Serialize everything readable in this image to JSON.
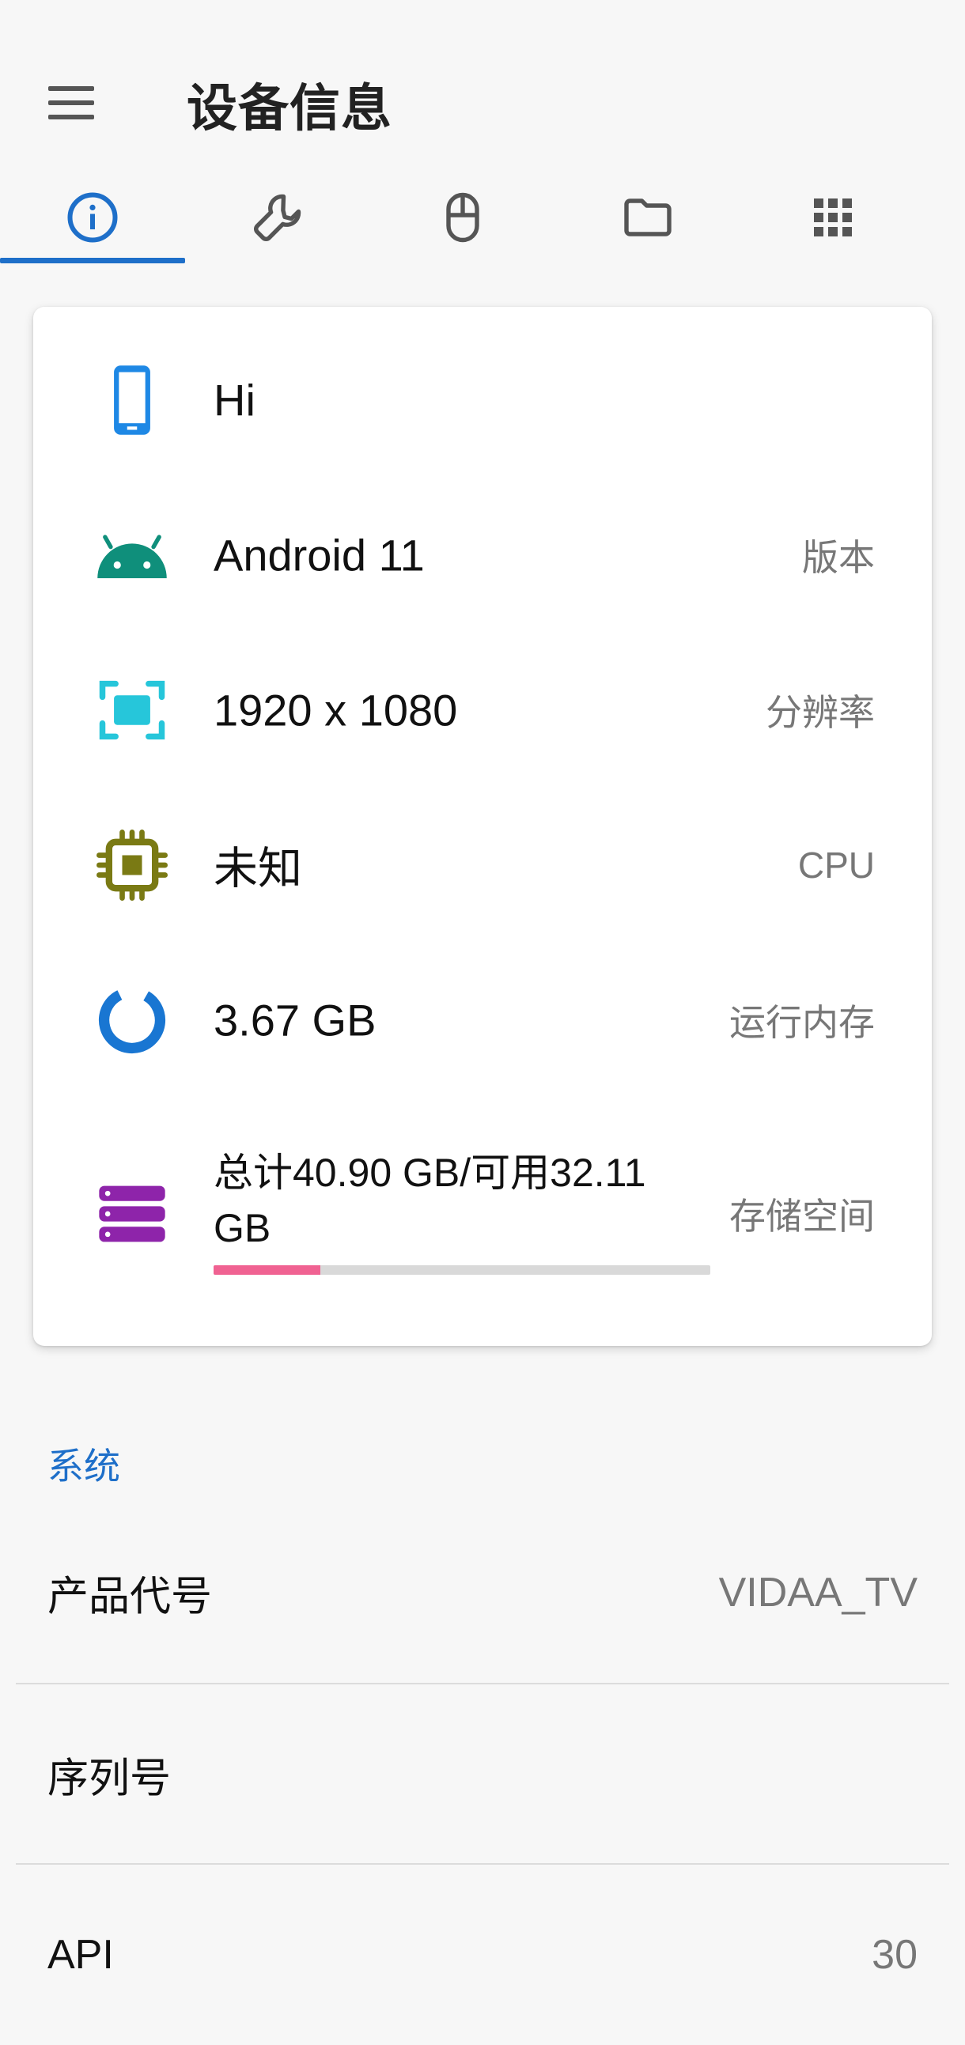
{
  "app": {
    "title": "设备信息"
  },
  "tabs": [
    {
      "name": "info",
      "icon": "info-icon",
      "selected": true
    },
    {
      "name": "tools",
      "icon": "wrench-icon",
      "selected": false
    },
    {
      "name": "mouse",
      "icon": "mouse-icon",
      "selected": false
    },
    {
      "name": "files",
      "icon": "folder-icon",
      "selected": false
    },
    {
      "name": "apps",
      "icon": "grid-icon",
      "selected": false
    }
  ],
  "colors": {
    "accent": "#1e6fc9",
    "phone": "#1e88e5",
    "android": "#0f8f7b",
    "screen": "#26c6da",
    "cpu": "#7a7a14",
    "ram": "#1976d2",
    "storage": "#8e24aa",
    "storage_bar": "#f06292"
  },
  "summary": {
    "device": {
      "value": "Hi",
      "icon": "phone-icon"
    },
    "version": {
      "value": "Android 11",
      "label": "版本",
      "icon": "android-icon"
    },
    "resolution": {
      "value": "1920 x 1080",
      "label": "分辨率",
      "icon": "screen-icon"
    },
    "cpu": {
      "value": "未知",
      "label": "CPU",
      "icon": "chip-icon"
    },
    "ram": {
      "value": "3.67 GB",
      "label": "运行内存",
      "icon": "ring-icon"
    },
    "storage": {
      "value": "总计40.90 GB/可用32.11 GB",
      "label": "存储空间",
      "icon": "storage-icon",
      "used_fraction": 0.215
    }
  },
  "system": {
    "section_title": "系统",
    "rows": [
      {
        "key": "产品代号",
        "value": "VIDAA_TV"
      },
      {
        "key": "序列号",
        "value": ""
      },
      {
        "key": "API",
        "value": "30"
      }
    ]
  }
}
